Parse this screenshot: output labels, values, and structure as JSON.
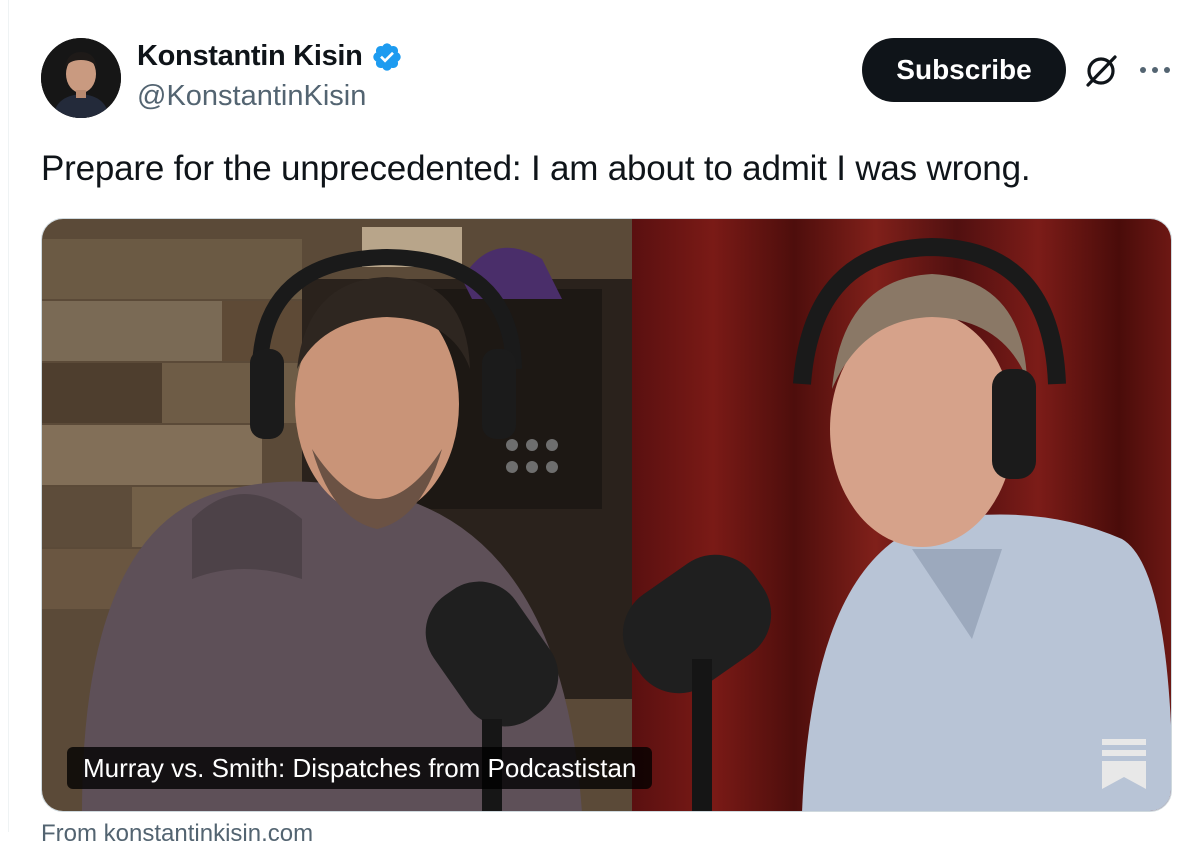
{
  "author": {
    "name": "Konstantin Kisin",
    "handle": "@KonstantinKisin"
  },
  "actions": {
    "subscribe_label": "Subscribe"
  },
  "icons": {
    "verified": "verified-badge-icon",
    "grok": "grok-icon",
    "more": "more-options-icon",
    "substack": "substack-icon"
  },
  "tweet": {
    "text": "Prepare for the unprecedented: I am about to admit I was wrong."
  },
  "card": {
    "caption": "Murray vs. Smith: Dispatches from Podcastistan",
    "source": "From konstantinkisin.com"
  },
  "colors": {
    "verified_blue": "#1d9bf0",
    "text_primary": "#0f1419",
    "text_secondary": "#536471",
    "subscribe_bg": "#0f1419"
  }
}
